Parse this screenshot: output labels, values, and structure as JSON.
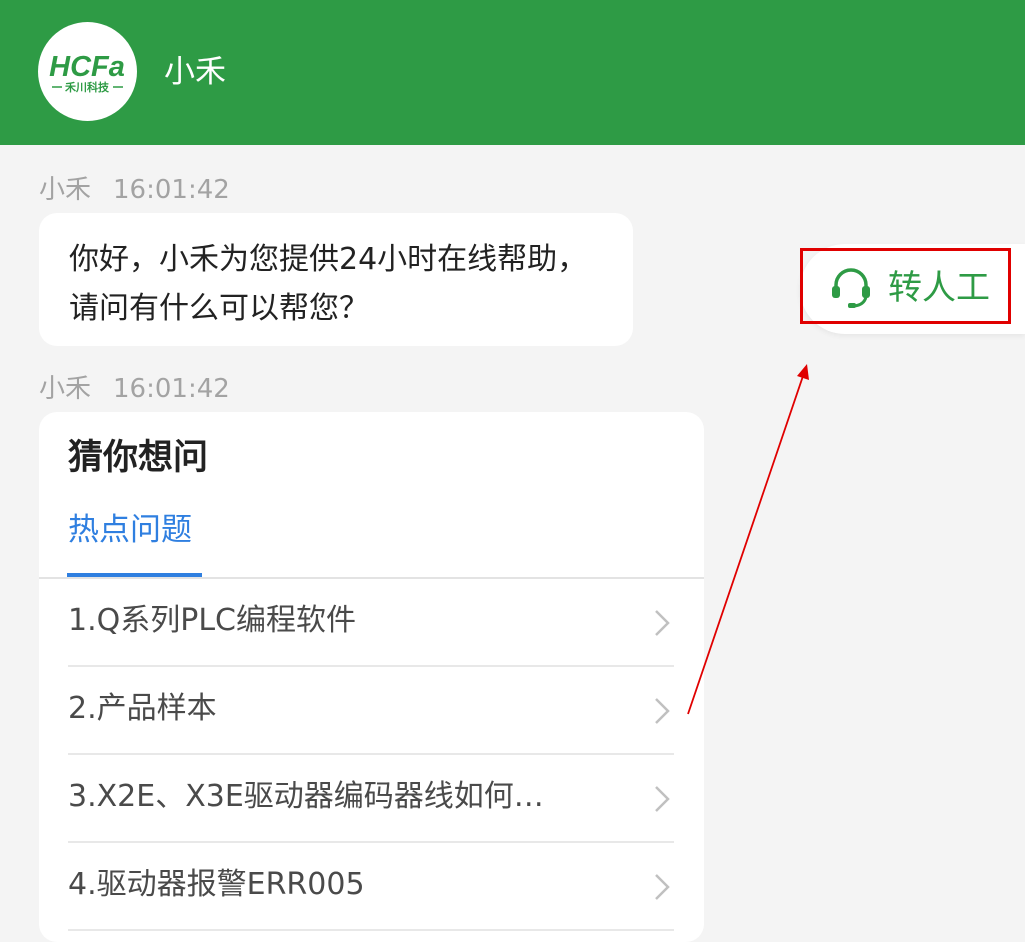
{
  "header": {
    "title": "小禾",
    "logo": {
      "brand": "HCFa",
      "subtitle": "禾川科技",
      "color": "#2e9b45"
    }
  },
  "messages": [
    {
      "sender": "小禾",
      "time": "16:01:42",
      "text": "你好，小禾为您提供24小时在线帮助，请问有什么可以帮您？"
    },
    {
      "sender": "小禾",
      "time": "16:01:42"
    }
  ],
  "card": {
    "title": "猜你想问",
    "tab": "热点问题",
    "questions": [
      "1.Q系列PLC编程软件",
      "2.产品样本",
      "3.X2E、X3E驱动器编码器线如何…",
      "4.驱动器报警ERR005"
    ]
  },
  "transfer": {
    "label": "转人工",
    "icon": "headset-icon"
  },
  "colors": {
    "brand_green": "#2e9b45",
    "accent_blue": "#2f7fe0",
    "annotation_red": "#e00000"
  }
}
